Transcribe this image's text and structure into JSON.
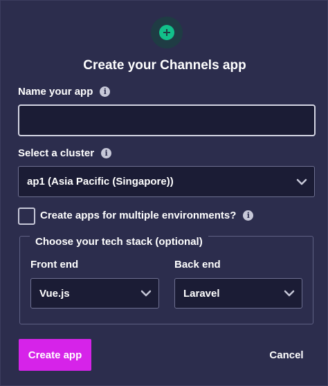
{
  "modal": {
    "title": "Create your Channels app"
  },
  "icons": {
    "top": "plus-circle-icon",
    "info": "info-icon",
    "chevron": "chevron-down-icon"
  },
  "colors": {
    "background": "#2c2d4d",
    "input_background": "#1b1c35",
    "accent": "#d623e9",
    "icon_green": "#12c08a"
  },
  "name_field": {
    "label": "Name your app",
    "value": "",
    "placeholder": ""
  },
  "cluster": {
    "label": "Select a cluster",
    "value": "ap1 (Asia Pacific (Singapore))"
  },
  "multi_env": {
    "label": "Create apps for multiple environments?",
    "checked": false
  },
  "tech_stack": {
    "legend": "Choose your tech stack (optional)",
    "frontend": {
      "label": "Front end",
      "value": "Vue.js"
    },
    "backend": {
      "label": "Back end",
      "value": "Laravel"
    }
  },
  "actions": {
    "create_label": "Create app",
    "cancel_label": "Cancel"
  }
}
